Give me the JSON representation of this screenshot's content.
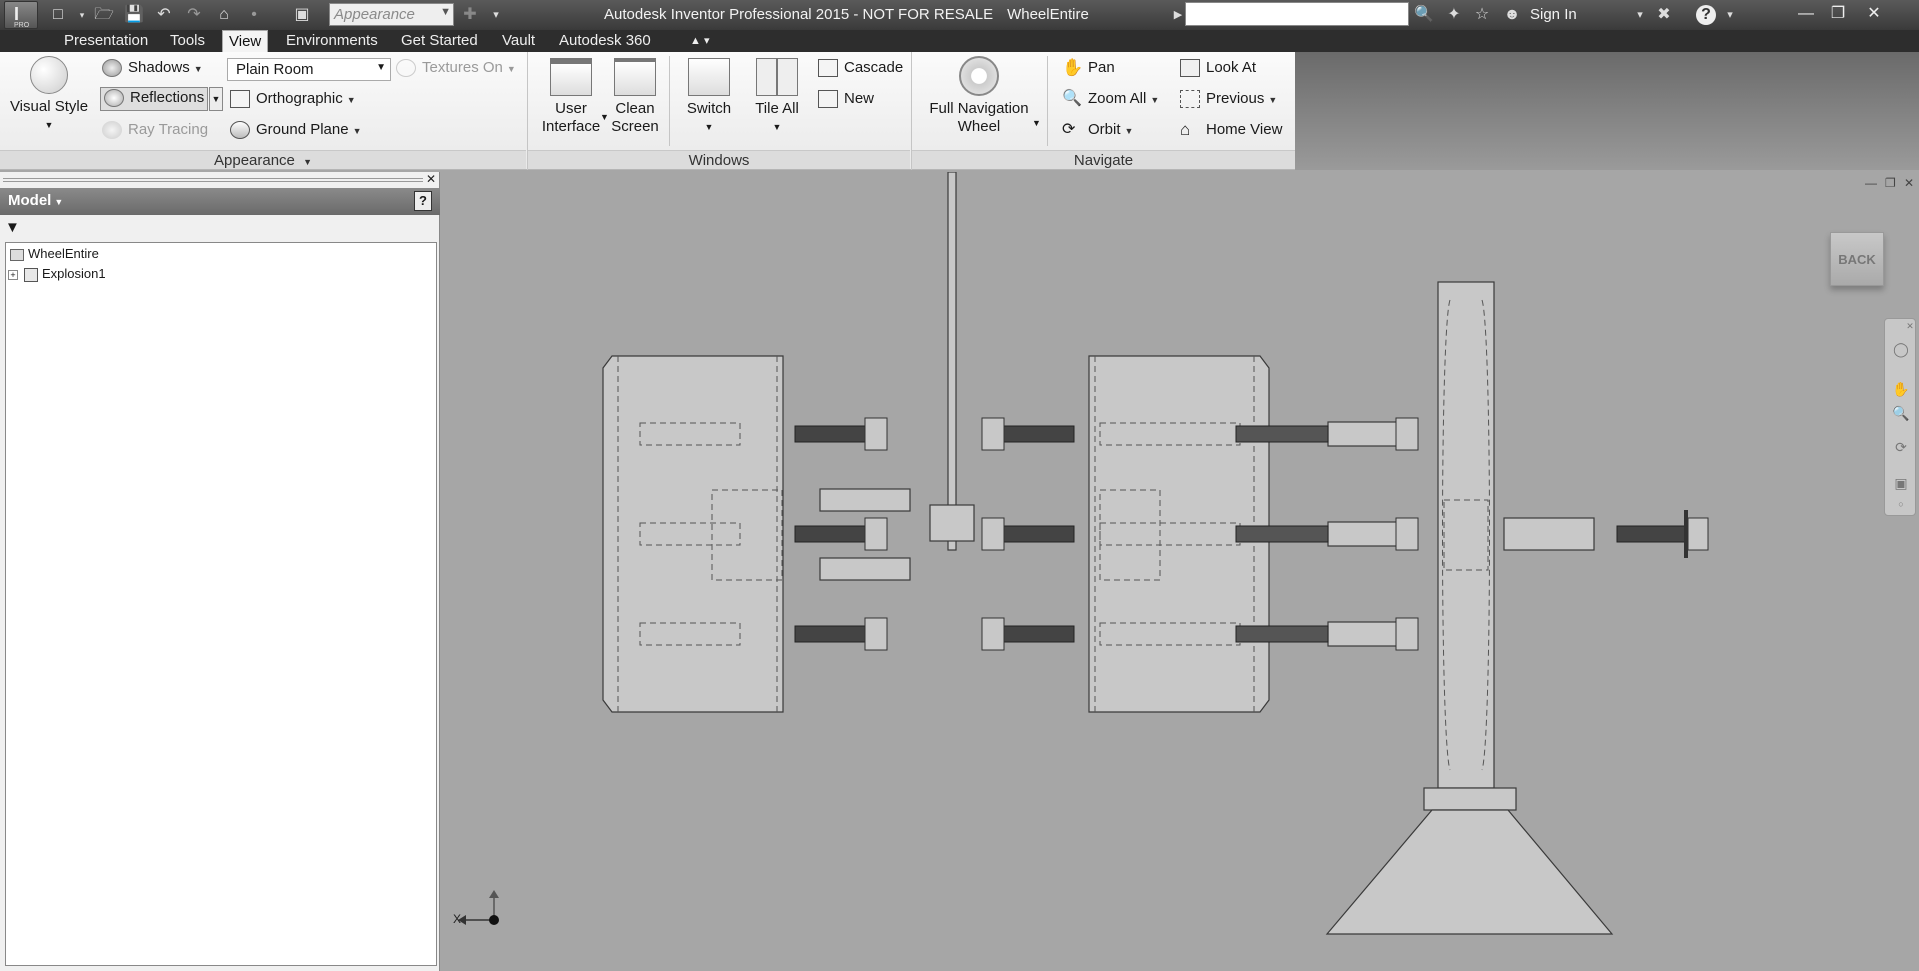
{
  "titlebar": {
    "app_name": "Autodesk Inventor Professional 2015 - NOT FOR RESALE",
    "document": "WheelEntire",
    "app_button": "PRO",
    "appearance_combo": "Appearance",
    "sign_in": "Sign In"
  },
  "tabs": [
    "Presentation",
    "Tools",
    "View",
    "Environments",
    "Get Started",
    "Vault",
    "Autodesk 360"
  ],
  "ribbon": {
    "appearance": {
      "title": "Appearance",
      "visual_style": "Visual Style",
      "shadows": "Shadows",
      "reflections": "Reflections",
      "ray_tracing": "Ray Tracing",
      "environment": "Plain Room",
      "textures_on": "Textures On",
      "orthographic": "Orthographic",
      "ground_plane": "Ground Plane"
    },
    "windows": {
      "title": "Windows",
      "user_interface_1": "User",
      "user_interface_2": "Interface",
      "clean_screen_1": "Clean",
      "clean_screen_2": "Screen",
      "switch": "Switch",
      "tile_all": "Tile All",
      "cascade": "Cascade",
      "new": "New"
    },
    "navigate": {
      "title": "Navigate",
      "full_nav_1": "Full Navigation",
      "full_nav_2": "Wheel",
      "pan": "Pan",
      "zoom_all": "Zoom All",
      "orbit": "Orbit",
      "look_at": "Look At",
      "previous": "Previous",
      "home_view": "Home View"
    }
  },
  "browser": {
    "header": "Model",
    "tree": [
      "WheelEntire",
      "Explosion1"
    ]
  },
  "viewport": {
    "viewcube": "BACK",
    "axis_x": "X"
  }
}
